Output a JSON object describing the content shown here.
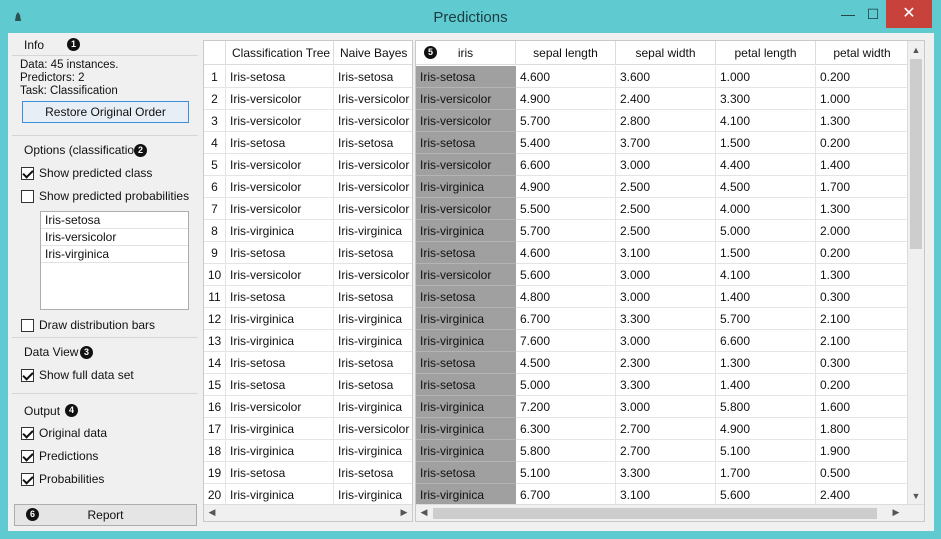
{
  "window": {
    "title": "Predictions",
    "min_glyph": "—",
    "max_glyph": "☐",
    "close_glyph": "✕"
  },
  "info": {
    "label": "Info",
    "badge": "1",
    "line1": "Data: 45 instances.",
    "line2": "Predictors: 2",
    "line3": "Task: Classification",
    "restore_label": "Restore Original Order"
  },
  "options": {
    "label": "Options (classification)",
    "badge": "2",
    "show_predicted_class": "Show predicted class",
    "show_predicted_probabilities": "Show predicted probabilities",
    "classes": [
      "Iris-setosa",
      "Iris-versicolor",
      "Iris-virginica"
    ],
    "draw_distribution_bars": "Draw distribution bars"
  },
  "data_view": {
    "label": "Data View",
    "badge": "3",
    "show_full": "Show full data set"
  },
  "output": {
    "label": "Output",
    "badge": "4",
    "original": "Original data",
    "predictions": "Predictions",
    "probabilities": "Probabilities"
  },
  "report": {
    "badge": "6",
    "label": "Report"
  },
  "table_badge": "5",
  "predictions_table": {
    "headers": [
      "Classification Tree",
      "Naive Bayes"
    ],
    "rows": [
      [
        "1",
        "Iris-setosa",
        "Iris-setosa"
      ],
      [
        "2",
        "Iris-versicolor",
        "Iris-versicolor"
      ],
      [
        "3",
        "Iris-versicolor",
        "Iris-versicolor"
      ],
      [
        "4",
        "Iris-setosa",
        "Iris-setosa"
      ],
      [
        "5",
        "Iris-versicolor",
        "Iris-versicolor"
      ],
      [
        "6",
        "Iris-versicolor",
        "Iris-versicolor"
      ],
      [
        "7",
        "Iris-versicolor",
        "Iris-versicolor"
      ],
      [
        "8",
        "Iris-virginica",
        "Iris-virginica"
      ],
      [
        "9",
        "Iris-setosa",
        "Iris-setosa"
      ],
      [
        "10",
        "Iris-versicolor",
        "Iris-versicolor"
      ],
      [
        "11",
        "Iris-setosa",
        "Iris-setosa"
      ],
      [
        "12",
        "Iris-virginica",
        "Iris-virginica"
      ],
      [
        "13",
        "Iris-virginica",
        "Iris-virginica"
      ],
      [
        "14",
        "Iris-setosa",
        "Iris-setosa"
      ],
      [
        "15",
        "Iris-setosa",
        "Iris-setosa"
      ],
      [
        "16",
        "Iris-versicolor",
        "Iris-virginica"
      ],
      [
        "17",
        "Iris-virginica",
        "Iris-versicolor"
      ],
      [
        "18",
        "Iris-virginica",
        "Iris-virginica"
      ],
      [
        "19",
        "Iris-setosa",
        "Iris-setosa"
      ],
      [
        "20",
        "Iris-virginica",
        "Iris-virginica"
      ]
    ]
  },
  "data_table": {
    "headers": [
      "iris",
      "sepal length",
      "sepal width",
      "petal length",
      "petal width"
    ],
    "rows": [
      [
        "Iris-setosa",
        "4.600",
        "3.600",
        "1.000",
        "0.200"
      ],
      [
        "Iris-versicolor",
        "4.900",
        "2.400",
        "3.300",
        "1.000"
      ],
      [
        "Iris-versicolor",
        "5.700",
        "2.800",
        "4.100",
        "1.300"
      ],
      [
        "Iris-setosa",
        "5.400",
        "3.700",
        "1.500",
        "0.200"
      ],
      [
        "Iris-versicolor",
        "6.600",
        "3.000",
        "4.400",
        "1.400"
      ],
      [
        "Iris-virginica",
        "4.900",
        "2.500",
        "4.500",
        "1.700"
      ],
      [
        "Iris-versicolor",
        "5.500",
        "2.500",
        "4.000",
        "1.300"
      ],
      [
        "Iris-virginica",
        "5.700",
        "2.500",
        "5.000",
        "2.000"
      ],
      [
        "Iris-setosa",
        "4.600",
        "3.100",
        "1.500",
        "0.200"
      ],
      [
        "Iris-versicolor",
        "5.600",
        "3.000",
        "4.100",
        "1.300"
      ],
      [
        "Iris-setosa",
        "4.800",
        "3.000",
        "1.400",
        "0.300"
      ],
      [
        "Iris-virginica",
        "6.700",
        "3.300",
        "5.700",
        "2.100"
      ],
      [
        "Iris-virginica",
        "7.600",
        "3.000",
        "6.600",
        "2.100"
      ],
      [
        "Iris-setosa",
        "4.500",
        "2.300",
        "1.300",
        "0.300"
      ],
      [
        "Iris-setosa",
        "5.000",
        "3.300",
        "1.400",
        "0.200"
      ],
      [
        "Iris-virginica",
        "7.200",
        "3.000",
        "5.800",
        "1.600"
      ],
      [
        "Iris-virginica",
        "6.300",
        "2.700",
        "4.900",
        "1.800"
      ],
      [
        "Iris-virginica",
        "5.800",
        "2.700",
        "5.100",
        "1.900"
      ],
      [
        "Iris-setosa",
        "5.100",
        "3.300",
        "1.700",
        "0.500"
      ],
      [
        "Iris-virginica",
        "6.700",
        "3.100",
        "5.600",
        "2.400"
      ]
    ]
  },
  "colors": {
    "titlebar": "#5fcad0",
    "close": "#c7423a",
    "iris_cell": "#a0a0a0"
  }
}
